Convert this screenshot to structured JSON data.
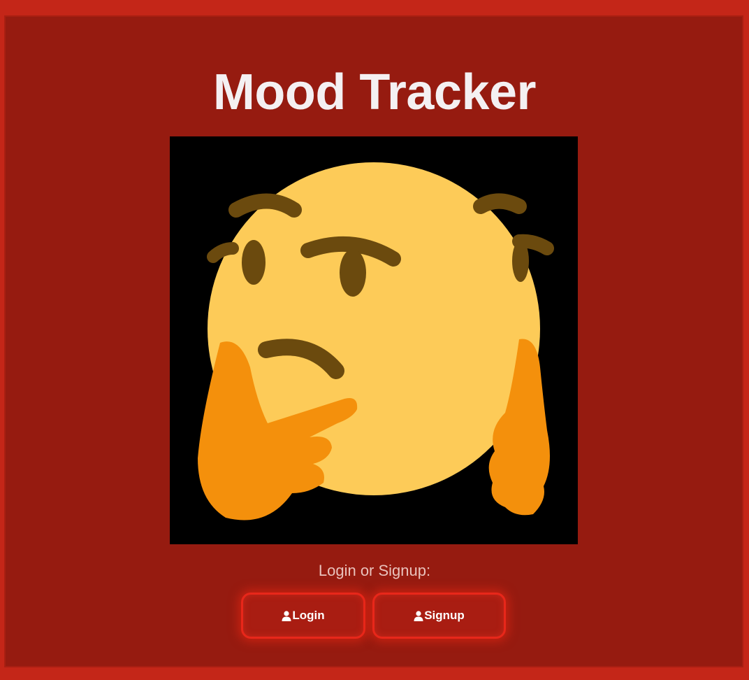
{
  "title": "Mood Tracker",
  "hero": {
    "icon": "thinking-face-emoji"
  },
  "auth": {
    "prompt": "Login or Signup:",
    "login_label": "Login",
    "signup_label": "Signup",
    "button_icon": "user-icon"
  },
  "colors": {
    "background": "#961b10",
    "border": "#c42618",
    "button_glow": "#e8271a",
    "title": "#f4f0f2"
  }
}
